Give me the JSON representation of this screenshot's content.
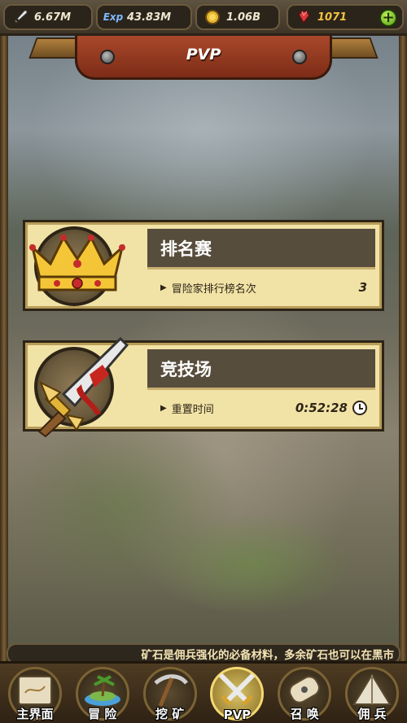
{
  "resources": [
    {
      "name": "attack",
      "icon": "sword-icon",
      "value": "6.67M"
    },
    {
      "name": "exp",
      "icon": "exp-icon",
      "value": "43.83M"
    },
    {
      "name": "gold",
      "icon": "gold-coin-icon",
      "value": "1.06B"
    },
    {
      "name": "ruby",
      "icon": "ruby-gem-icon",
      "value": "1071"
    }
  ],
  "exp_icon_text": "Exp",
  "banner": {
    "title": "PVP"
  },
  "cards": [
    {
      "title": "排名赛",
      "sub_label": "冒险家排行榜名次",
      "value": "3",
      "icon": "crown-icon"
    },
    {
      "title": "竞技场",
      "sub_label": "重置时间",
      "value": "0:52:28",
      "icon": "bloody-sword-icon"
    }
  ],
  "ticker": "矿石是佣兵强化的必备材料，多余矿石也可以在黑市",
  "nav": [
    {
      "label": "主界面",
      "icon": "scroll-map-icon",
      "active": false
    },
    {
      "label": "冒 险",
      "icon": "island-icon",
      "active": false
    },
    {
      "label": "挖 矿",
      "icon": "pickaxe-icon",
      "active": false
    },
    {
      "label": "PVP",
      "icon": "crossed-swords-icon",
      "active": true
    },
    {
      "label": "召 唤",
      "icon": "summon-scroll-icon",
      "active": false
    },
    {
      "label": "佣 兵",
      "icon": "tent-icon",
      "active": false
    }
  ],
  "colors": {
    "accent_gold": "#f3c341",
    "banner_red": "#a8482a",
    "card_bg": "#f1e2a6"
  }
}
